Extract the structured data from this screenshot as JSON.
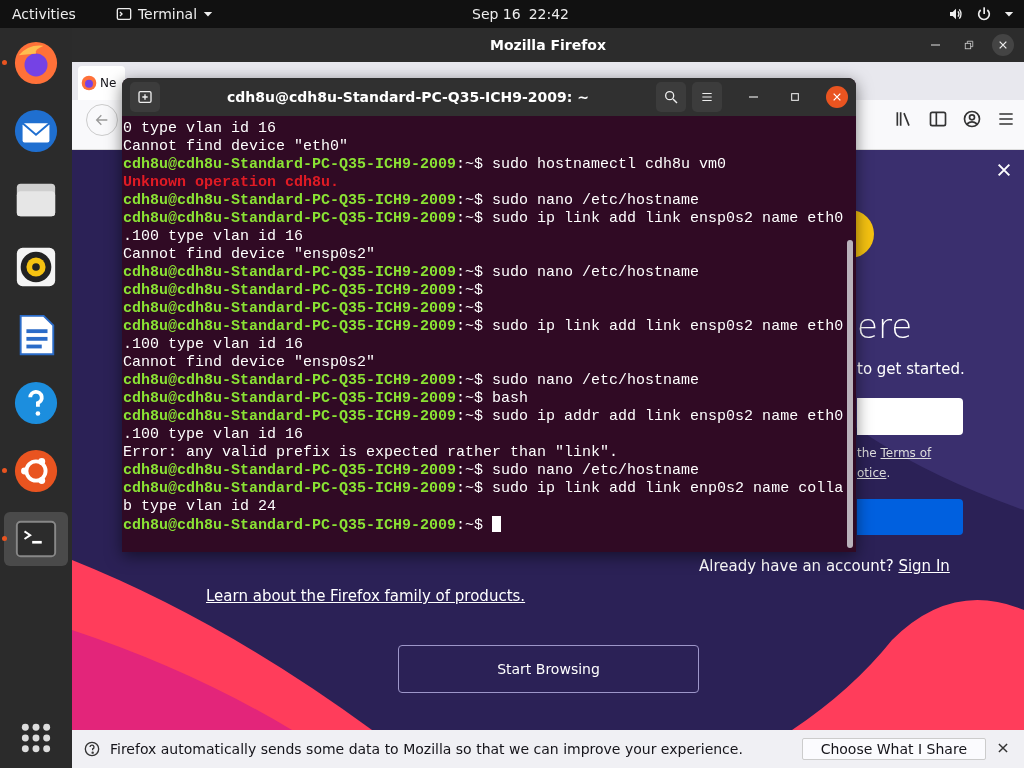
{
  "top_bar": {
    "activities": "Activities",
    "app_menu": "Terminal",
    "date": "Sep 16",
    "time": "22:42"
  },
  "dock": {
    "items": [
      {
        "kind": "firefox",
        "running": true,
        "active": false
      },
      {
        "kind": "thunderbird",
        "running": false,
        "active": false
      },
      {
        "kind": "files",
        "running": false,
        "active": false
      },
      {
        "kind": "rhythmbox",
        "running": false,
        "active": false
      },
      {
        "kind": "writer",
        "running": false,
        "active": false
      },
      {
        "kind": "help",
        "running": false,
        "active": false
      },
      {
        "kind": "software",
        "running": true,
        "active": false
      },
      {
        "kind": "terminal",
        "running": true,
        "active": true
      }
    ]
  },
  "firefox": {
    "title": "Mozilla Firefox",
    "tabs": [
      {
        "label": "Ne",
        "selected": true
      }
    ],
    "page": {
      "heading": "ere",
      "subtitle": "to get started.",
      "terms_prefix": "the ",
      "terms_link": "Terms of",
      "notice_link": "otice",
      "notice_end": ".",
      "account_prompt": "Already have an account?",
      "sign_in": "Sign In",
      "learn_link": "Learn about the Firefox family of products.",
      "start_button": "Start Browsing"
    },
    "notification": {
      "message": "Firefox automatically sends some data to Mozilla so that we can improve your experience.",
      "button": "Choose What I Share"
    }
  },
  "terminal": {
    "title": "cdh8u@cdh8u-Standard-PC-Q35-ICH9-2009: ~",
    "lines": [
      {
        "kind": "output",
        "text": "0 type vlan id 16"
      },
      {
        "kind": "output",
        "text": "Cannot find device \"eth0\""
      },
      {
        "kind": "prompt",
        "user": "cdh8u@cdh8u-Standard-PC-Q35-ICH9-2009",
        "tail": ":~$",
        "command": "sudo hostnamectl cdh8u vm0"
      },
      {
        "kind": "error",
        "text": "Unknown operation cdh8u."
      },
      {
        "kind": "prompt",
        "user": "cdh8u@cdh8u-Standard-PC-Q35-ICH9-2009",
        "tail": ":~$",
        "command": "sudo nano /etc/hostname"
      },
      {
        "kind": "prompt",
        "user": "cdh8u@cdh8u-Standard-PC-Q35-ICH9-2009",
        "tail": ":~$",
        "command": "sudo ip link add link ensp0s2 name eth0"
      },
      {
        "kind": "output",
        "text": ".100 type vlan id 16"
      },
      {
        "kind": "output",
        "text": "Cannot find device \"ensp0s2\""
      },
      {
        "kind": "prompt",
        "user": "cdh8u@cdh8u-Standard-PC-Q35-ICH9-2009",
        "tail": ":~$",
        "command": "sudo nano /etc/hostname"
      },
      {
        "kind": "prompt",
        "user": "cdh8u@cdh8u-Standard-PC-Q35-ICH9-2009",
        "tail": ":~$"
      },
      {
        "kind": "prompt",
        "user": "cdh8u@cdh8u-Standard-PC-Q35-ICH9-2009",
        "tail": ":~$"
      },
      {
        "kind": "prompt",
        "user": "cdh8u@cdh8u-Standard-PC-Q35-ICH9-2009",
        "tail": ":~$",
        "command": "sudo ip link add link ensp0s2 name eth0"
      },
      {
        "kind": "output",
        "text": ".100 type vlan id 16"
      },
      {
        "kind": "output",
        "text": "Cannot find device \"ensp0s2\""
      },
      {
        "kind": "prompt",
        "user": "cdh8u@cdh8u-Standard-PC-Q35-ICH9-2009",
        "tail": ":~$",
        "command": "sudo nano /etc/hostname"
      },
      {
        "kind": "prompt",
        "user": "cdh8u@cdh8u-Standard-PC-Q35-ICH9-2009",
        "tail": ":~$",
        "command": "bash"
      },
      {
        "kind": "prompt",
        "user": "cdh8u@cdh8u-Standard-PC-Q35-ICH9-2009",
        "tail": ":~$",
        "command": "sudo ip addr add link ensp0s2 name eth0"
      },
      {
        "kind": "output",
        "text": ".100 type vlan id 16"
      },
      {
        "kind": "output",
        "text": "Error: any valid prefix is expected rather than \"link\"."
      },
      {
        "kind": "prompt",
        "user": "cdh8u@cdh8u-Standard-PC-Q35-ICH9-2009",
        "tail": ":~$",
        "command": "sudo nano /etc/hostname"
      },
      {
        "kind": "prompt",
        "user": "cdh8u@cdh8u-Standard-PC-Q35-ICH9-2009",
        "tail": ":~$",
        "command": "sudo ip link add link enp0s2 name colla"
      },
      {
        "kind": "output",
        "text": "b type vlan id 24"
      },
      {
        "kind": "prompt",
        "user": "cdh8u@cdh8u-Standard-PC-Q35-ICH9-2009",
        "tail": ":~$",
        "cursor": true
      }
    ]
  }
}
